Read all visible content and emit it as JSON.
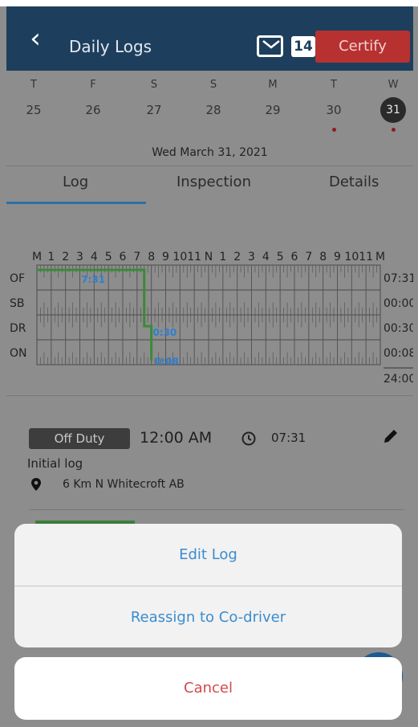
{
  "header": {
    "back_icon": "chevron-left-icon",
    "title": "Daily Logs",
    "mail_icon": "envelope-icon",
    "badge": "14",
    "certify_label": "Certify"
  },
  "week": {
    "days": [
      {
        "dow": "T",
        "num": "25",
        "selected": false,
        "dot": false
      },
      {
        "dow": "F",
        "num": "26",
        "selected": false,
        "dot": false
      },
      {
        "dow": "S",
        "num": "27",
        "selected": false,
        "dot": false
      },
      {
        "dow": "S",
        "num": "28",
        "selected": false,
        "dot": false
      },
      {
        "dow": "M",
        "num": "29",
        "selected": false,
        "dot": false
      },
      {
        "dow": "T",
        "num": "30",
        "selected": false,
        "dot": true
      },
      {
        "dow": "W",
        "num": "31",
        "selected": true,
        "dot": true
      }
    ],
    "full_date": "Wed March 31, 2021",
    "dot_color": "#8c1f1f"
  },
  "tabs": [
    "Log",
    "Inspection",
    "Details"
  ],
  "active_tab": "Log",
  "log_chart": {
    "hour_labels": [
      "M",
      "1",
      "2",
      "3",
      "4",
      "5",
      "6",
      "7",
      "8",
      "9",
      "10",
      "11",
      "N",
      "1",
      "2",
      "3",
      "4",
      "5",
      "6",
      "7",
      "8",
      "9",
      "10",
      "11",
      "M"
    ],
    "rows": [
      "OF",
      "SB",
      "DR",
      "ON"
    ],
    "totals": [
      "07:31",
      "00:00",
      "00:30",
      "00:08"
    ],
    "grand_total": "24:00",
    "segment_labels": [
      "7:31",
      "0:30",
      "0:08"
    ],
    "line_color": "#3a8a3a",
    "label_color": "#2f7fd0"
  },
  "entry": {
    "status": "Off Duty",
    "time": "12:00 AM",
    "duration": "07:31",
    "note": "Initial log",
    "location": "6 Km N Whitecroft AB"
  },
  "action_sheet": {
    "items": [
      "Edit Log",
      "Reassign to Co-driver"
    ],
    "cancel": "Cancel",
    "accent": "#3b8ccd",
    "cancel_color": "#d24a4a"
  }
}
